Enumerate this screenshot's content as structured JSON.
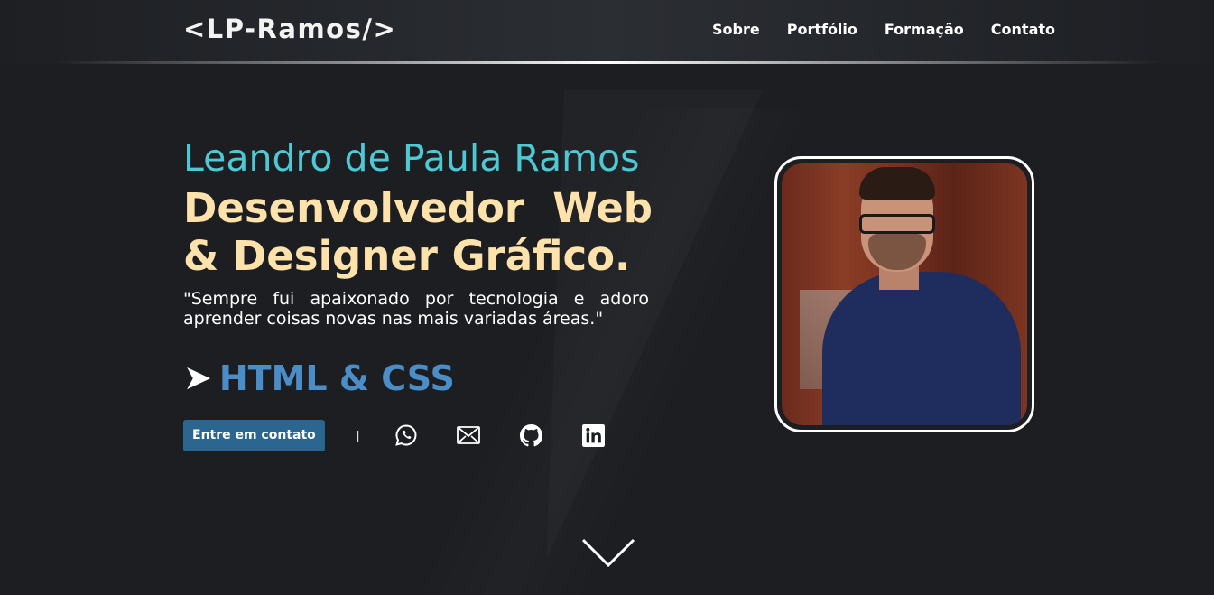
{
  "header": {
    "logo": "<LP-Ramos/>",
    "nav": [
      "Sobre",
      "Portfólio",
      "Formação",
      "Contato"
    ]
  },
  "hero": {
    "name": "Leandro de Paula Ramos",
    "role": "Desenvolvedor Web & Designer Gráfico.",
    "quote": "\"Sempre fui apaixonado por tecnologia e adoro aprender coisas novas nas mais variadas áreas.\"",
    "skill_arrow": "➤",
    "skill": "HTML & CSS",
    "contact_button": "Entre em contato",
    "separator": "|",
    "social_icons": [
      "whatsapp-icon",
      "mail-icon",
      "github-icon",
      "linkedin-icon"
    ]
  },
  "colors": {
    "background": "#1c1e22",
    "name": "#4ec9d4",
    "role": "#fde2ac",
    "skill": "#4b8dc6",
    "button": "#2b6690"
  }
}
